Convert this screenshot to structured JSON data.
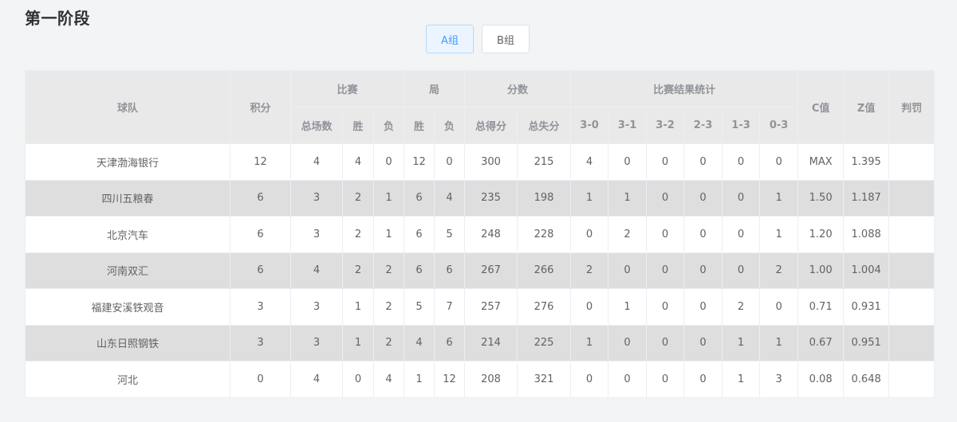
{
  "page_title": "第一阶段",
  "tabs": [
    {
      "label": "A组",
      "active": true
    },
    {
      "label": "B组",
      "active": false
    }
  ],
  "table": {
    "headers": {
      "team": "球队",
      "points": "积分",
      "matches": "比赛",
      "sets": "局",
      "scores": "分数",
      "results": "比赛结果统计",
      "c_value": "C值",
      "z_value": "Z值",
      "penalty": "判罚",
      "total_matches": "总场数",
      "win": "胜",
      "loss": "负",
      "total_scored": "总得分",
      "total_conceded": "总失分",
      "r30": "3-0",
      "r31": "3-1",
      "r32": "3-2",
      "r23": "2-3",
      "r13": "1-3",
      "r03": "0-3"
    },
    "rows": [
      {
        "team": "天津渤海银行",
        "points": "12",
        "matches": "4",
        "mw": "4",
        "ml": "0",
        "sw": "12",
        "sl": "0",
        "scored": "300",
        "conceded": "215",
        "r30": "4",
        "r31": "0",
        "r32": "0",
        "r23": "0",
        "r13": "0",
        "r03": "0",
        "c": "MAX",
        "z": "1.395",
        "penalty": ""
      },
      {
        "team": "四川五粮春",
        "points": "6",
        "matches": "3",
        "mw": "2",
        "ml": "1",
        "sw": "6",
        "sl": "4",
        "scored": "235",
        "conceded": "198",
        "r30": "1",
        "r31": "1",
        "r32": "0",
        "r23": "0",
        "r13": "0",
        "r03": "1",
        "c": "1.50",
        "z": "1.187",
        "penalty": ""
      },
      {
        "team": "北京汽车",
        "points": "6",
        "matches": "3",
        "mw": "2",
        "ml": "1",
        "sw": "6",
        "sl": "5",
        "scored": "248",
        "conceded": "228",
        "r30": "0",
        "r31": "2",
        "r32": "0",
        "r23": "0",
        "r13": "0",
        "r03": "1",
        "c": "1.20",
        "z": "1.088",
        "penalty": ""
      },
      {
        "team": "河南双汇",
        "points": "6",
        "matches": "4",
        "mw": "2",
        "ml": "2",
        "sw": "6",
        "sl": "6",
        "scored": "267",
        "conceded": "266",
        "r30": "2",
        "r31": "0",
        "r32": "0",
        "r23": "0",
        "r13": "0",
        "r03": "2",
        "c": "1.00",
        "z": "1.004",
        "penalty": ""
      },
      {
        "team": "福建安溪铁观音",
        "points": "3",
        "matches": "3",
        "mw": "1",
        "ml": "2",
        "sw": "5",
        "sl": "7",
        "scored": "257",
        "conceded": "276",
        "r30": "0",
        "r31": "1",
        "r32": "0",
        "r23": "0",
        "r13": "2",
        "r03": "0",
        "c": "0.71",
        "z": "0.931",
        "penalty": ""
      },
      {
        "team": "山东日照钢铁",
        "points": "3",
        "matches": "3",
        "mw": "1",
        "ml": "2",
        "sw": "4",
        "sl": "6",
        "scored": "214",
        "conceded": "225",
        "r30": "1",
        "r31": "0",
        "r32": "0",
        "r23": "0",
        "r13": "1",
        "r03": "1",
        "c": "0.67",
        "z": "0.951",
        "penalty": ""
      },
      {
        "team": "河北",
        "points": "0",
        "matches": "4",
        "mw": "0",
        "ml": "4",
        "sw": "1",
        "sl": "12",
        "scored": "208",
        "conceded": "321",
        "r30": "0",
        "r31": "0",
        "r32": "0",
        "r23": "0",
        "r13": "1",
        "r03": "3",
        "c": "0.08",
        "z": "0.648",
        "penalty": ""
      }
    ]
  }
}
